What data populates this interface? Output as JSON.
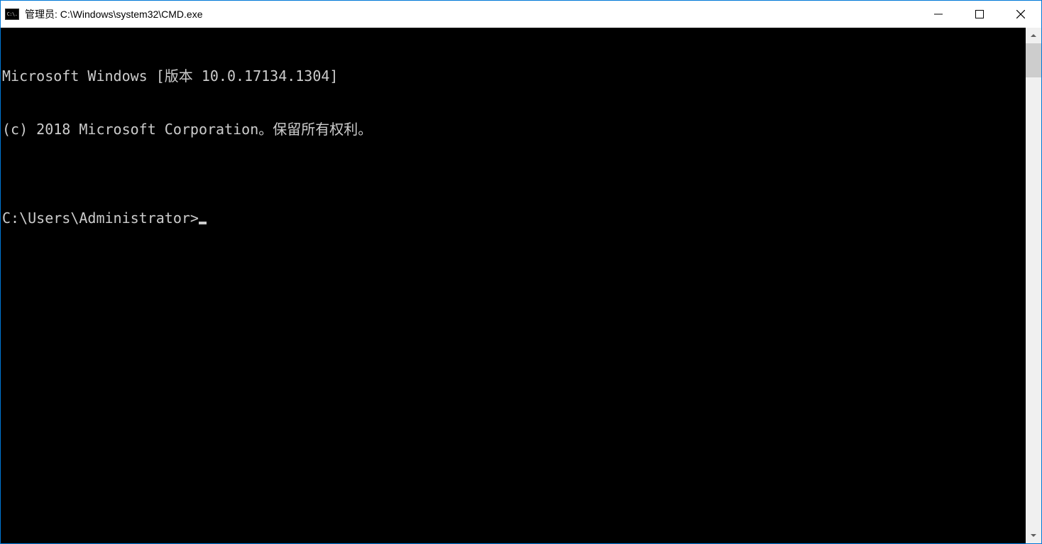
{
  "window": {
    "title": "管理员: C:\\Windows\\system32\\CMD.exe",
    "icon_text": "C:\\."
  },
  "terminal": {
    "lines": [
      "Microsoft Windows [版本 10.0.17134.1304]",
      "(c) 2018 Microsoft Corporation。保留所有权利。",
      ""
    ],
    "prompt": "C:\\Users\\Administrator>"
  }
}
